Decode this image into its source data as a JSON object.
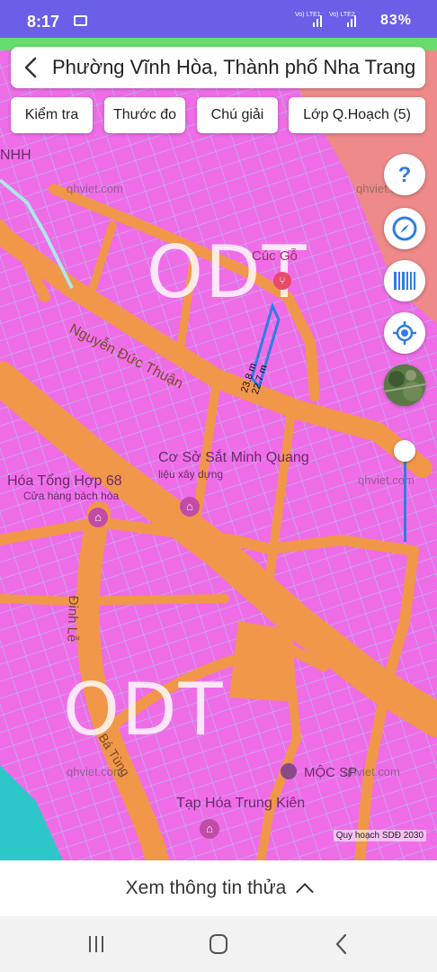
{
  "status": {
    "time": "8:17",
    "net1": "Vo) LTE1",
    "net2": "Vo) LTE2",
    "battery": "83%"
  },
  "header": {
    "title": "Phường Vĩnh Hòa, Thành phố Nha Trang"
  },
  "toolbar": {
    "check_label": "Kiểm tra",
    "measure_label": "Thước đo",
    "legend_label": "Chú giải",
    "layer_label": "Lớp Q.Hoạch (5)"
  },
  "map": {
    "zone_label_1": "ODT",
    "zone_label_2": "ODT",
    "road_1": "Nguyễn Đức Thuận",
    "road_2": "Đinh Lễ",
    "road_3": "Bá Tùng",
    "poi_1": "Cúc Gỗ",
    "poi_2": "Cơ Sở Sắt Minh Quang",
    "poi_2_sub": "liệu xây dựng",
    "poi_3": "Hóa Tổng Hợp 68",
    "poi_3_sub": "Cửa hàng bách hóa",
    "poi_4": "Tạp Hóa Trung Kiên",
    "poi_5": "MỘC SP",
    "poi_6": "NHH",
    "watermark": "qhviet.com",
    "measure_1": "23.8 m",
    "measure_2": "22.7 m",
    "layer_caption": "Quy hoạch SDĐ 2030",
    "colors": {
      "residential": "#f06de8",
      "road": "#f0974a",
      "green": "#ee8a8a",
      "water": "#2ec7c9",
      "accent": "#2f7de1"
    },
    "icons": [
      "help-icon",
      "compass-icon",
      "barcode-icon",
      "my-location-icon",
      "satellite-layer-icon"
    ]
  },
  "sheet": {
    "label": "Xem thông tin thửa"
  }
}
